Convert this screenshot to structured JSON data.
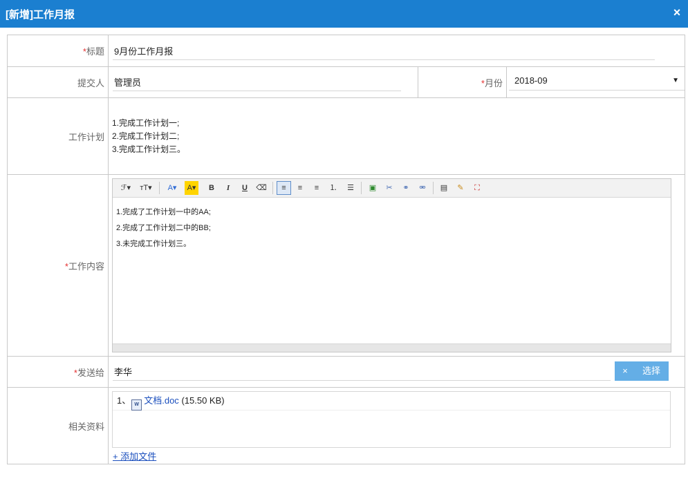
{
  "window": {
    "title": "[新增]工作月报",
    "close": "×"
  },
  "form": {
    "title_label": "标题",
    "title_value": "9月份工作月报",
    "submitter_label": "提交人",
    "submitter_value": "管理员",
    "month_label": "月份",
    "month_value": "2018-09",
    "plan_label": "工作计划",
    "plan_lines": [
      "1.完成工作计划一;",
      "2.完成工作计划二;",
      "3.完成工作计划三。"
    ],
    "content_label": "工作内容",
    "content_lines": [
      "1.完成了工作计划一中的AA;",
      "2.完成了工作计划二中的BB;",
      "3.未完成工作计划三。"
    ],
    "send_label": "发送给",
    "send_value": "李华",
    "clear_label": "×",
    "choose_label": "选择",
    "attach_label": "相关资料",
    "attach_index": "1、",
    "attach_file": "文档.doc",
    "attach_size": "(15.50 KB)",
    "add_file": "+ 添加文件",
    "required_mark": "*"
  },
  "toolbar": {
    "font": "ℱ▾",
    "size": "ᴛT▾",
    "color": "A▾",
    "bg": "A▾",
    "bold": "B",
    "italic": "I",
    "underline": "U",
    "erase": "⌫",
    "left": "≡",
    "center": "≡",
    "right": "≡",
    "ol": "⒈",
    "ul": "☰",
    "image": "▣",
    "cut": "✂",
    "link": "⚭",
    "unlink": "⚮",
    "paste": "▤",
    "clean": "✎",
    "full": "⛶"
  },
  "colors": {
    "header": "#1b7fd0",
    "required": "#e53030",
    "button": "#64aee6"
  }
}
